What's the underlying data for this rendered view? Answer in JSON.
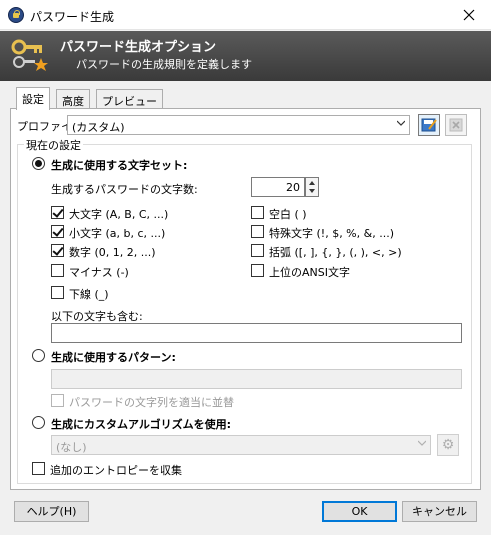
{
  "window": {
    "title": "パスワード生成"
  },
  "banner": {
    "title": "パスワード生成オプション",
    "subtitle": "パスワードの生成規則を定義します"
  },
  "tabs": [
    {
      "label": "設定",
      "active": true
    },
    {
      "label": "高度",
      "active": false
    },
    {
      "label": "プレビュー",
      "active": false
    }
  ],
  "profile": {
    "label": "プロファイル:",
    "value": "(カスタム)"
  },
  "group": {
    "title": "現在の設定"
  },
  "charset": {
    "label": "生成に使用する文字セット:",
    "selected": true,
    "length_label": "生成するパスワードの文字数:",
    "length_value": "20",
    "options": [
      {
        "label": "大文字 (A, B, C, ...)",
        "checked": true
      },
      {
        "label": "空白 ( )",
        "checked": false
      },
      {
        "label": "小文字 (a, b, c, ...)",
        "checked": true
      },
      {
        "label": "特殊文字 (!, $, %, &, ...)",
        "checked": false
      },
      {
        "label": "数字 (0, 1, 2, ...)",
        "checked": true
      },
      {
        "label": "括弧 ([, ], {, }, (, ), <, >)",
        "checked": false
      },
      {
        "label": "マイナス (-)",
        "checked": false
      },
      {
        "label": "上位のANSI文字",
        "checked": false
      },
      {
        "label": "下線 (_)",
        "checked": false
      }
    ],
    "include_label": "以下の文字も含む:",
    "include_value": ""
  },
  "pattern": {
    "label": "生成に使用するパターン:",
    "selected": false,
    "value": "",
    "shuffle_label": "パスワードの文字列を適当に並替",
    "shuffle_checked": false
  },
  "algorithm": {
    "label": "生成にカスタムアルゴリズムを使用:",
    "selected": false,
    "value": "(なし)"
  },
  "entropy": {
    "label": "追加のエントロピーを収集",
    "checked": false
  },
  "buttons": {
    "help": "ヘルプ(H)",
    "ok": "OK",
    "cancel": "キャンセル"
  },
  "colors": {
    "accent": "#0078d7",
    "banner": "#4a4a4a"
  }
}
